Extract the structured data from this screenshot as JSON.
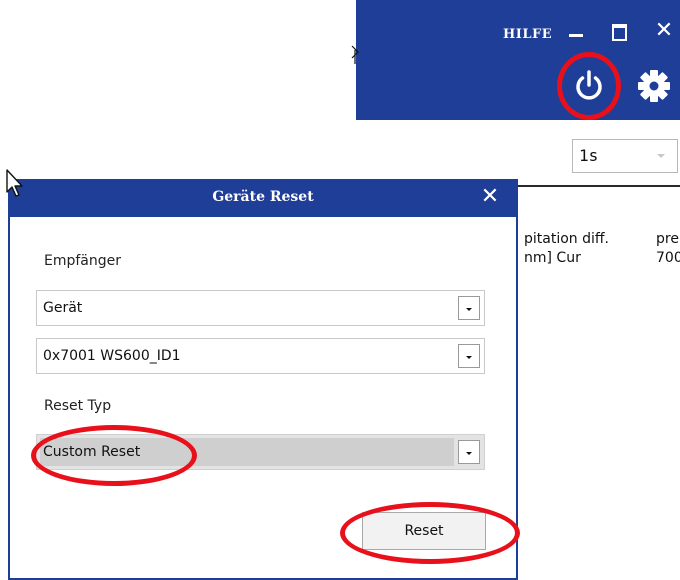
{
  "app": {
    "help_label": "HILFE",
    "interval": "1s",
    "columns": [
      {
        "line1": "pitation diff.",
        "line2": "nm] Cur"
      },
      {
        "line1": "pre",
        "line2": "700"
      }
    ]
  },
  "dialog": {
    "title": "Geräte Reset",
    "receiver_label": "Empfänger",
    "receiver_type": "Gerät",
    "device": "0x7001 WS600_ID1",
    "reset_type_label": "Reset Typ",
    "reset_type": "Custom Reset",
    "reset_button": "Reset"
  },
  "colors": {
    "titlebar": "#1f3e98",
    "annotation": "#e8101a"
  },
  "icons": [
    "power-icon",
    "gear-icon",
    "minimize-icon",
    "maximize-icon",
    "close-icon",
    "pointer-cursor-icon"
  ]
}
